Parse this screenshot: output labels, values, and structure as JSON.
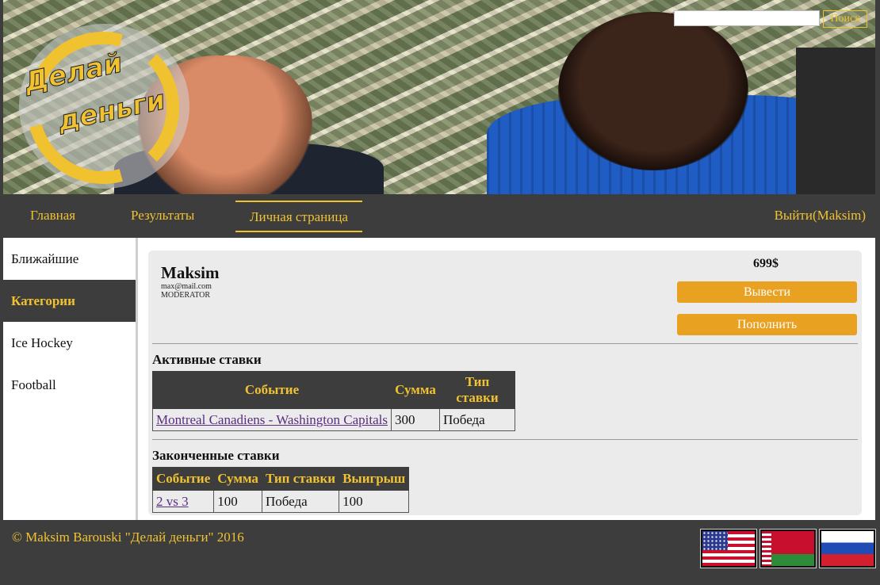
{
  "header": {
    "logo_line1": "Делай",
    "logo_line2": "деньги",
    "search": {
      "placeholder": "",
      "value": "",
      "button_label": "Поиск"
    }
  },
  "nav": {
    "items": [
      {
        "label": "Главная"
      },
      {
        "label": "Результаты"
      },
      {
        "label": "Личная страница"
      }
    ],
    "active": "Личная страница",
    "logout_label": "Выйти(Maksim)"
  },
  "sidebar": {
    "items": [
      {
        "label": "Ближайшие"
      },
      {
        "label": "Категории"
      },
      {
        "label": "Ice Hockey"
      },
      {
        "label": "Football"
      }
    ],
    "active": "Категории"
  },
  "profile": {
    "name": "Maksim",
    "email": "max@mail.com",
    "role": "MODERATOR",
    "balance": "699$",
    "withdraw_label": "Вывести",
    "deposit_label": "Пополнить"
  },
  "active_bets": {
    "title": "Активные ставки",
    "headers": [
      "Событие",
      "Сумма",
      "Тип ставки"
    ],
    "rows": [
      {
        "event": "Montreal Canadiens - Washington Capitals",
        "amount": "300",
        "type": "Победа"
      }
    ]
  },
  "finished_bets": {
    "title": "Законченные ставки",
    "headers": [
      "Событие",
      "Сумма",
      "Тип ставки",
      "Выигрыш"
    ],
    "rows": [
      {
        "event": "2 vs 3",
        "amount": "100",
        "type": "Победа",
        "win": "100"
      }
    ]
  },
  "footer": {
    "copyright": "© Maksim Barouski \"Делай деньги\" 2016",
    "flags": [
      "us-flag-icon",
      "belarus-flag-icon",
      "russia-flag-icon"
    ]
  },
  "colors": {
    "accent": "#f1c230",
    "button": "#e8a120",
    "dark": "#3d3d3d"
  }
}
